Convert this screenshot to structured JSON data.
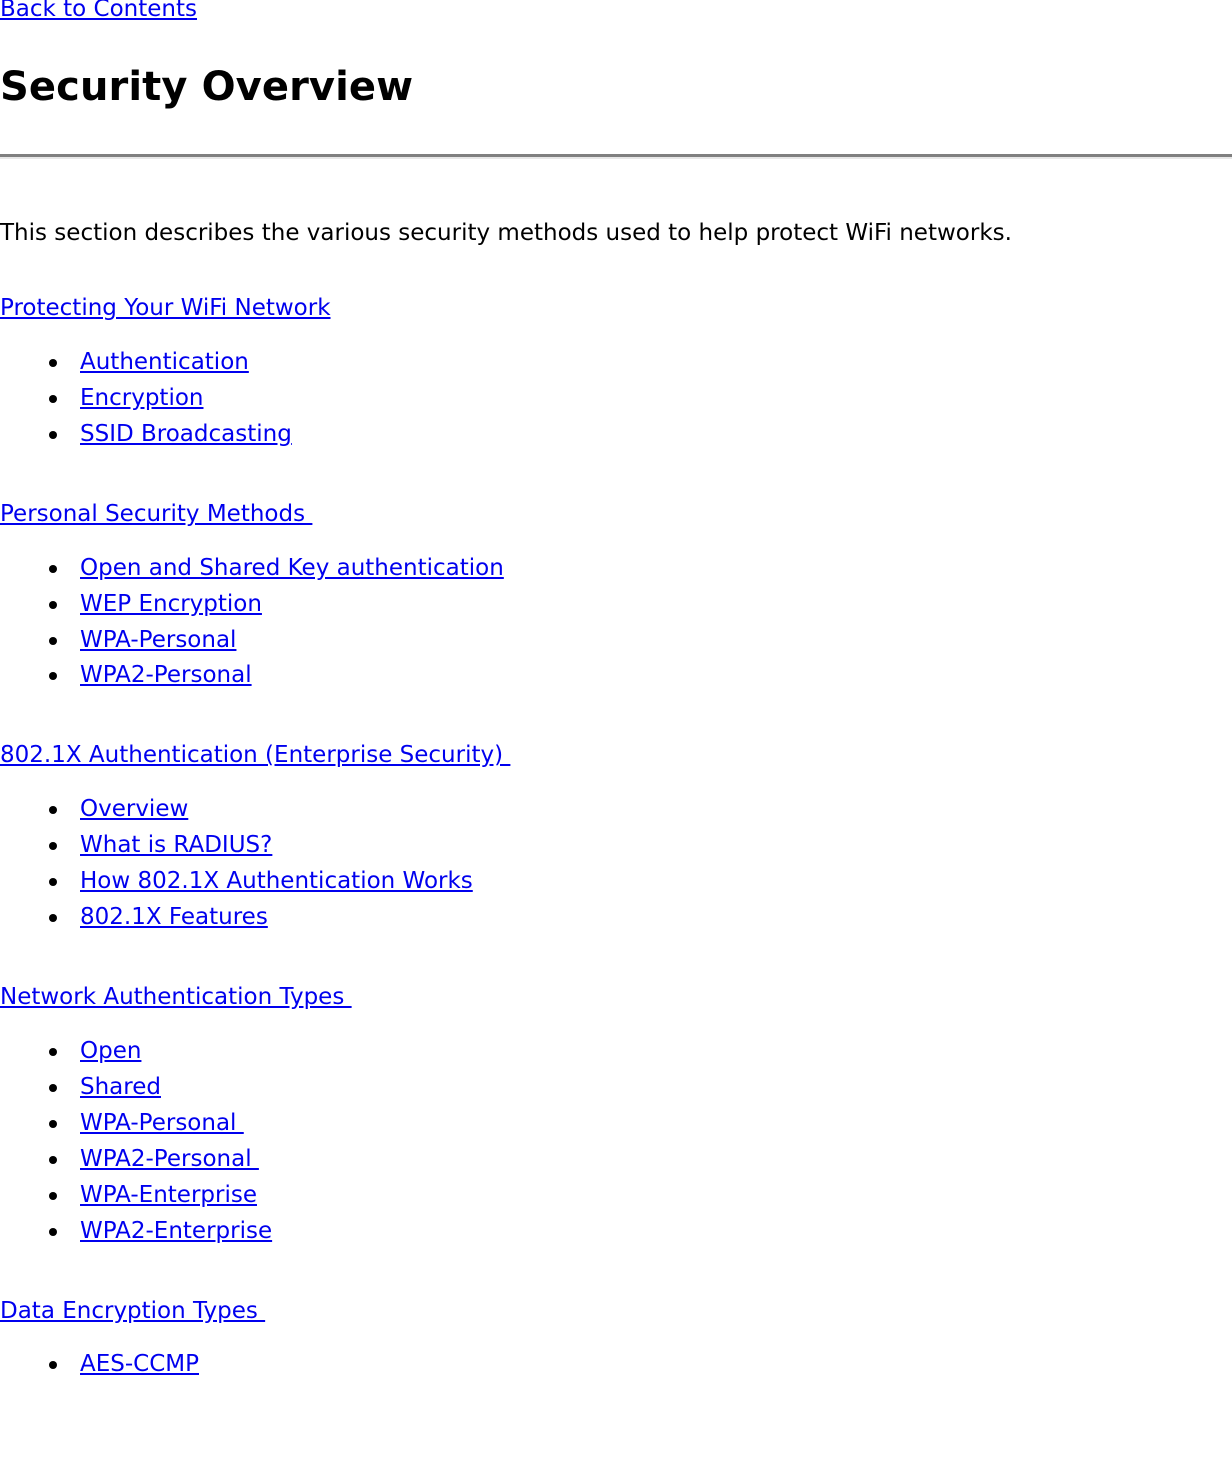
{
  "nav": {
    "back_link": "Back to Contents"
  },
  "header": {
    "title": "Security Overview"
  },
  "intro": {
    "paragraph": "This section describes the various security methods used to help protect WiFi networks."
  },
  "colors": {
    "link": "#0000EE",
    "text": "#000000",
    "rule": "#808080",
    "background": "#FFFFFF"
  },
  "sections": [
    {
      "heading": "Protecting Your WiFi Network",
      "items": [
        "Authentication",
        "Encryption",
        "SSID Broadcasting"
      ]
    },
    {
      "heading": "Personal Security Methods ",
      "items": [
        "Open and Shared Key authentication",
        "WEP Encryption",
        "WPA-Personal",
        "WPA2-Personal"
      ]
    },
    {
      "heading": "802.1X Authentication (Enterprise Security) ",
      "items": [
        "Overview",
        "What is RADIUS?",
        "How 802.1X Authentication Works",
        "802.1X Features"
      ]
    },
    {
      "heading": "Network Authentication Types ",
      "items": [
        "Open",
        "Shared",
        "WPA-Personal ",
        "WPA2-Personal ",
        "WPA-Enterprise",
        "WPA2-Enterprise"
      ]
    },
    {
      "heading": "Data Encryption Types ",
      "items": [
        "AES-CCMP"
      ]
    }
  ]
}
